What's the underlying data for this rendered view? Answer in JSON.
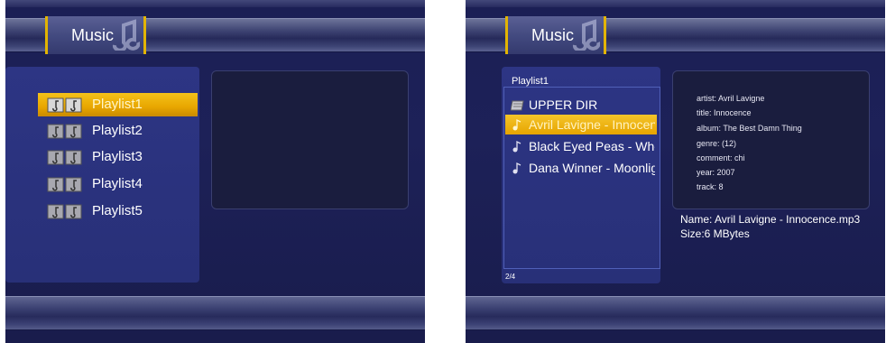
{
  "left": {
    "tab_label": "Music",
    "playlists": [
      {
        "label": "Playlist1",
        "selected": true
      },
      {
        "label": "Playlist2",
        "selected": false
      },
      {
        "label": "Playlist3",
        "selected": false
      },
      {
        "label": "Playlist4",
        "selected": false
      },
      {
        "label": "Playlist5",
        "selected": false
      }
    ]
  },
  "right": {
    "tab_label": "Music",
    "playlist_title": "Playlist1",
    "files": [
      {
        "label": "UPPER DIR",
        "icon": "folder-icon",
        "selected": false
      },
      {
        "label": "Avril Lavigne - Innocence",
        "icon": "music-note-icon",
        "selected": true
      },
      {
        "label": "Black Eyed Peas - Whe",
        "icon": "music-note-icon",
        "selected": false
      },
      {
        "label": "Dana Winner - Moonligl",
        "icon": "music-note-icon",
        "selected": false
      }
    ],
    "page_indicator": "2/4",
    "metadata": {
      "artist": "artist: Avril Lavigne",
      "title": "title: Innocence",
      "album": "album: The Best Damn Thing",
      "genre": "genre: (12)",
      "comment": "comment: chi",
      "year": "year: 2007",
      "track": "track: 8"
    },
    "file_name": "Name: Avril Lavigne - Innocence.mp3",
    "file_size": "Size:6 MBytes"
  },
  "colors": {
    "background": "#1b1f55",
    "panel": "#2b3380",
    "selection": "#f0b400",
    "text": "#ffffff"
  }
}
